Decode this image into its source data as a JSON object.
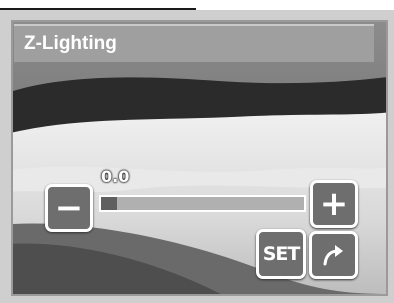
{
  "screen_title": "Z-Lighting",
  "slider": {
    "value_text": "0.0",
    "value": 0.0,
    "range": [
      -2.0,
      2.0
    ],
    "indicator_fraction": 0.08
  },
  "buttons": {
    "minus": "−",
    "plus": "+",
    "set": "SET",
    "return_icon": "return-arrow-icon"
  },
  "colors": {
    "title_bar": "#9f9f9f",
    "button_fill": "#6e6e6e",
    "button_border": "#ffffff",
    "slider_track": "#b0b0b0",
    "slider_indicator": "#5f5f5f"
  }
}
